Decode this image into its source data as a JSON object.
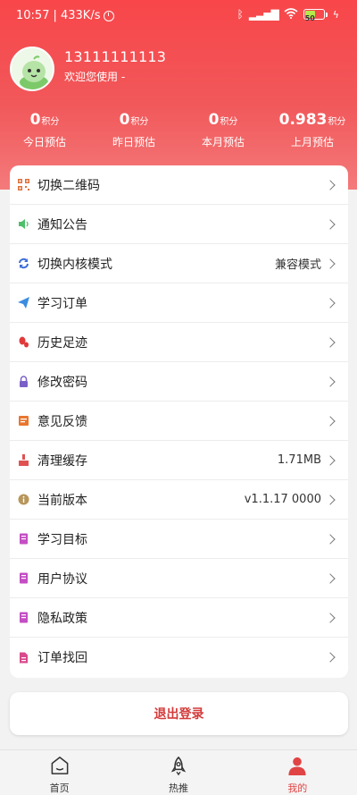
{
  "status_bar": {
    "time": "10:57",
    "speed": "| 433K/s",
    "battery": "50"
  },
  "profile": {
    "phone": "13111111113",
    "welcome": "欢迎您使用 -"
  },
  "stats": [
    {
      "value": "0",
      "unit": "积分",
      "label": "今日预估"
    },
    {
      "value": "0",
      "unit": "积分",
      "label": "昨日预估"
    },
    {
      "value": "0",
      "unit": "积分",
      "label": "本月预估"
    },
    {
      "value": "0.983",
      "unit": "积分",
      "label": "上月预估"
    }
  ],
  "menu": [
    {
      "label": "切换二维码",
      "value": "",
      "icon": "qrcode-icon",
      "color": "#e0703a"
    },
    {
      "label": "通知公告",
      "value": "",
      "icon": "speaker-icon",
      "color": "#4fbf6a"
    },
    {
      "label": "切换内核模式",
      "value": "兼容模式",
      "icon": "switch-icon",
      "color": "#3f6fd9"
    },
    {
      "label": "学习订单",
      "value": "",
      "icon": "paper-plane-icon",
      "color": "#3b8de0"
    },
    {
      "label": "历史足迹",
      "value": "",
      "icon": "footprint-icon",
      "color": "#e03a3a"
    },
    {
      "label": "修改密码",
      "value": "",
      "icon": "lock-icon",
      "color": "#7a5fc8"
    },
    {
      "label": "意见反馈",
      "value": "",
      "icon": "feedback-icon",
      "color": "#e8762e"
    },
    {
      "label": "清理缓存",
      "value": "1.71MB",
      "icon": "broom-icon",
      "color": "#e05252"
    },
    {
      "label": "当前版本",
      "value": "v1.1.17 0000",
      "icon": "info-icon",
      "color": "#b8965a"
    },
    {
      "label": "学习目标",
      "value": "",
      "icon": "book-icon",
      "color": "#c44ec4"
    },
    {
      "label": "用户协议",
      "value": "",
      "icon": "book-icon",
      "color": "#c44ec4"
    },
    {
      "label": "隐私政策",
      "value": "",
      "icon": "book-icon",
      "color": "#c44ec4"
    },
    {
      "label": "订单找回",
      "value": "",
      "icon": "document-icon",
      "color": "#d94a8c"
    }
  ],
  "logout_label": "退出登录",
  "nav": [
    {
      "label": "首页",
      "icon": "home-icon"
    },
    {
      "label": "热推",
      "icon": "rocket-icon"
    },
    {
      "label": "我的",
      "icon": "user-icon",
      "active": true
    }
  ]
}
